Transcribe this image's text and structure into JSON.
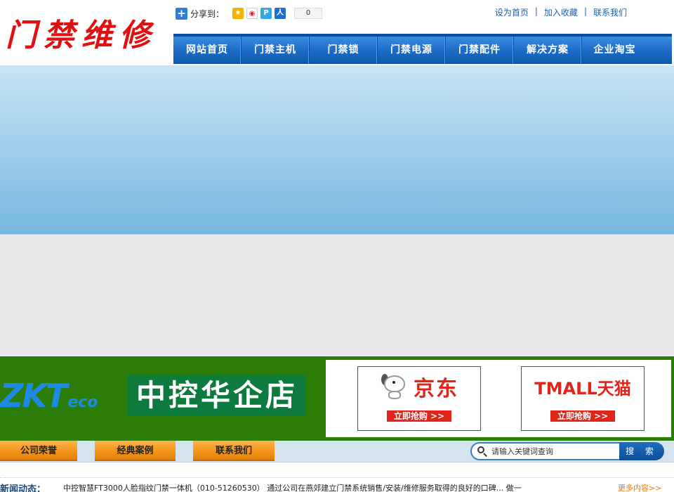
{
  "header": {
    "logo_text": "门禁维修",
    "share_label": "分享到：",
    "share_count": "0",
    "share_icons": [
      "qzone-icon",
      "weibo-icon",
      "tqq-icon",
      "renren-icon"
    ],
    "top_links": [
      "设为首页",
      "加入收藏",
      "联系我们"
    ]
  },
  "nav": {
    "items": [
      "网站首页",
      "门禁主机",
      "门禁锁",
      "门禁电源",
      "门禁配件",
      "解决方案",
      "企业淘宝"
    ]
  },
  "ad": {
    "brand": "ZKT",
    "brand_suffix": "eco",
    "store_name": "中控华企店",
    "jd_text": "京东",
    "jd_button": "立即抢购 >>",
    "tmall_text": "TMALL天猫",
    "tmall_button": "立即抢购 >>"
  },
  "tabs": [
    "公司荣誉",
    "经典案例",
    "联系我们"
  ],
  "search": {
    "placeholder": "请输入关键词查询",
    "button": "搜 索"
  },
  "news": {
    "label": "新闻动态：",
    "text": "中控智慧FT3000人脸指纹门禁一体机（010-51260530） 通过公司在燕郊建立门禁系统销售/安装/维修服务取得的良好的口碑... 做一",
    "more": "更多内容>>"
  },
  "colors": {
    "nav_blue": "#1c6cc7",
    "logo_red": "#e11010",
    "ad_green": "#2b7d07",
    "tab_orange": "#f39315"
  }
}
